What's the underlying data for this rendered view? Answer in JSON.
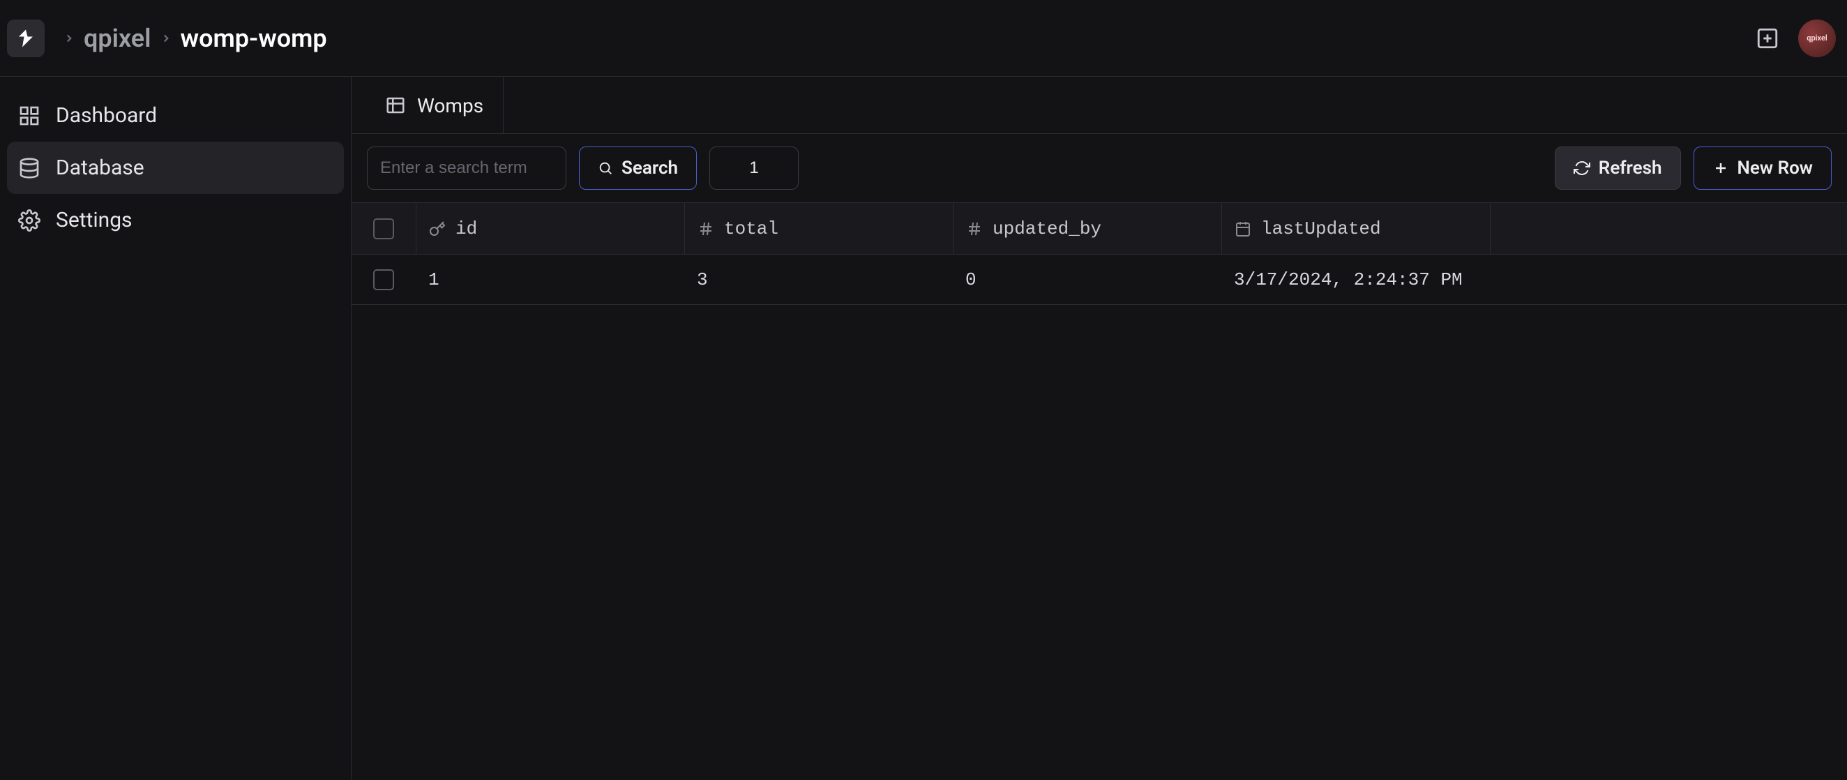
{
  "breadcrumb": {
    "org": "qpixel",
    "project": "womp-womp"
  },
  "avatar": {
    "label": "qpixel"
  },
  "sidebar": {
    "items": [
      {
        "label": "Dashboard"
      },
      {
        "label": "Database"
      },
      {
        "label": "Settings"
      }
    ]
  },
  "tabs": [
    {
      "label": "Womps"
    }
  ],
  "toolbar": {
    "search_placeholder": "Enter a search term",
    "search_btn": "Search",
    "page_value": "1",
    "refresh_btn": "Refresh",
    "newrow_btn": "New Row"
  },
  "columns": {
    "id": "id",
    "total": "total",
    "updated_by": "updated_by",
    "lastUpdated": "lastUpdated"
  },
  "rows": [
    {
      "id": "1",
      "total": "3",
      "updated_by": "0",
      "lastUpdated": "3/17/2024, 2:24:37 PM"
    }
  ]
}
